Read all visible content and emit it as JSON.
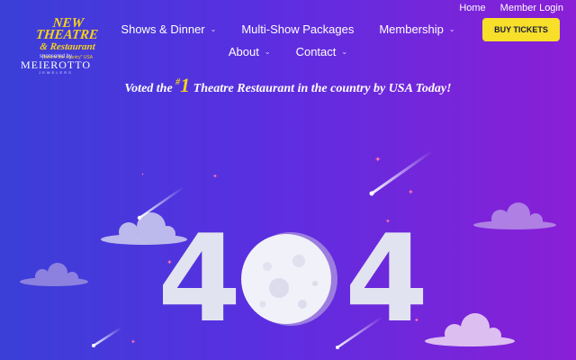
{
  "utility_nav": {
    "home": "Home",
    "member_login": "Member Login"
  },
  "logo": {
    "line1": "NEW THEATRE",
    "line2": "& Restaurant",
    "tagline": "\"best in the country\" USA"
  },
  "sponsor": {
    "label": "sponsored by",
    "name": "MEIEROTTO",
    "sub": "JEWELERS"
  },
  "main_nav": {
    "row1": [
      {
        "label": "Shows & Dinner",
        "dropdown": true
      },
      {
        "label": "Multi-Show Packages",
        "dropdown": false
      },
      {
        "label": "Membership",
        "dropdown": true
      }
    ],
    "row2": [
      {
        "label": "About",
        "dropdown": true
      },
      {
        "label": "Contact",
        "dropdown": true
      }
    ]
  },
  "buy_button": "BUY TICKETS",
  "banner": {
    "before": "Voted the",
    "rank_symbol": "#",
    "rank": "1",
    "after": "Theatre Restaurant in the country by USA Today!"
  },
  "error": {
    "left_digit": "4",
    "right_digit": "4"
  },
  "colors": {
    "accent_yellow": "#f7df2a",
    "gradient_start": "#3a3fd8",
    "gradient_end": "#8a1fd6",
    "digit": "#e2e3f0"
  },
  "icons": {
    "chevron": "chevron-down-icon",
    "moon": "moon-icon",
    "cloud": "cloud-icon",
    "shooting_star": "shooting-star-icon",
    "sparkle": "sparkle-icon"
  }
}
